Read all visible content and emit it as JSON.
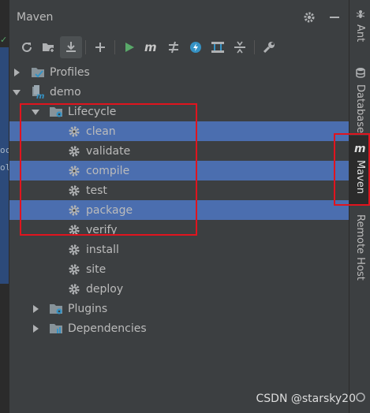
{
  "left_editor": {
    "fragments": [
      "oc",
      "ol"
    ]
  },
  "tool_window": {
    "title": "Maven",
    "toolbar": [
      {
        "name": "reload-icon"
      },
      {
        "name": "add-folder-icon"
      },
      {
        "name": "download-icon"
      },
      {
        "name": "add-icon"
      },
      {
        "name": "run-icon"
      },
      {
        "name": "maven-goal-icon"
      },
      {
        "name": "toggle-offline-icon"
      },
      {
        "name": "skip-tests-icon"
      },
      {
        "name": "show-dependencies-icon"
      },
      {
        "name": "collapse-all-icon"
      },
      {
        "name": "settings-wrench-icon"
      }
    ]
  },
  "tree": {
    "profiles": "Profiles",
    "project": "demo",
    "lifecycle": "Lifecycle",
    "goals": [
      "clean",
      "validate",
      "compile",
      "test",
      "package",
      "verify",
      "install",
      "site",
      "deploy"
    ],
    "selected_goals": [
      "clean",
      "compile",
      "package"
    ],
    "plugins": "Plugins",
    "dependencies": "Dependencies"
  },
  "right_stripe": {
    "ant": "Ant",
    "database": "Database",
    "maven": "Maven",
    "remote_host": "Remote Host"
  },
  "watermark": "CSDN @starsky20",
  "colors": {
    "selection": "#4b6eaf",
    "highlight_box": "#e0141e",
    "panel_bg": "#3c3f41"
  }
}
